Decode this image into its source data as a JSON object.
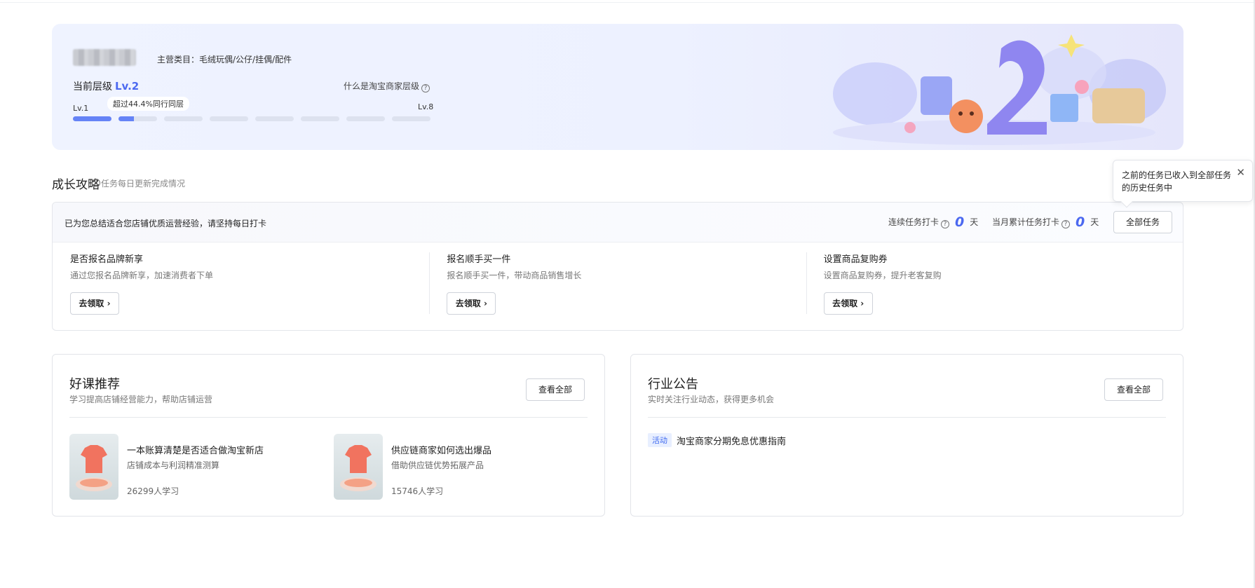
{
  "hero": {
    "category": "主营类目：毛绒玩偶/公仔/挂偶/配件",
    "level_label": "当前层级",
    "level_value": "Lv.2",
    "what_is_link": "什么是淘宝商家层级",
    "level_start": "Lv.1",
    "level_end": "Lv.8",
    "peer_tip": "超过44.4%同行同层",
    "progress": {
      "total_levels": 8,
      "completed": 1,
      "current_partial_percent": 40
    },
    "colors": {
      "accent": "#4c69f0",
      "progress": "#6583f6"
    }
  },
  "growth": {
    "title": "成长攻略",
    "subtitle": "任务每日更新完成情况",
    "tip": "已为您总结适合您店铺优质运营经验，请坚持每日打卡",
    "streak_label": "连续任务打卡",
    "streak_value": "0",
    "streak_unit": "天",
    "month_label": "当月累计任务打卡",
    "month_value": "0",
    "month_unit": "天",
    "all_tasks_button": "全部任务",
    "tasks": [
      {
        "title": "是否报名品牌新享",
        "desc": "通过您报名品牌新享，加速消费者下单",
        "button": "去领取"
      },
      {
        "title": "报名顺手买一件",
        "desc": "报名顺手买一件，带动商品销售增长",
        "button": "去领取"
      },
      {
        "title": "设置商品复购券",
        "desc": "设置商品复购券，提升老客复购",
        "button": "去领取"
      }
    ]
  },
  "popover": {
    "text": "之前的任务已收入到全部任务的历史任务中",
    "close_icon": "close-icon"
  },
  "courses": {
    "title": "好课推荐",
    "subtitle": "学习提高店铺经营能力，帮助店铺运营",
    "view_all": "查看全部",
    "items": [
      {
        "title": "一本账算清楚是否适合做淘宝新店",
        "desc": "店铺成本与利润精准测算",
        "count": "26299人学习"
      },
      {
        "title": "供应链商家如何选出爆品",
        "desc": "借助供应链优势拓展产品",
        "count": "15746人学习"
      }
    ]
  },
  "announcements": {
    "title": "行业公告",
    "subtitle": "实时关注行业动态，获得更多机会",
    "view_all": "查看全部",
    "items": [
      {
        "tag": "活动",
        "text": "淘宝商家分期免息优惠指南"
      }
    ]
  }
}
